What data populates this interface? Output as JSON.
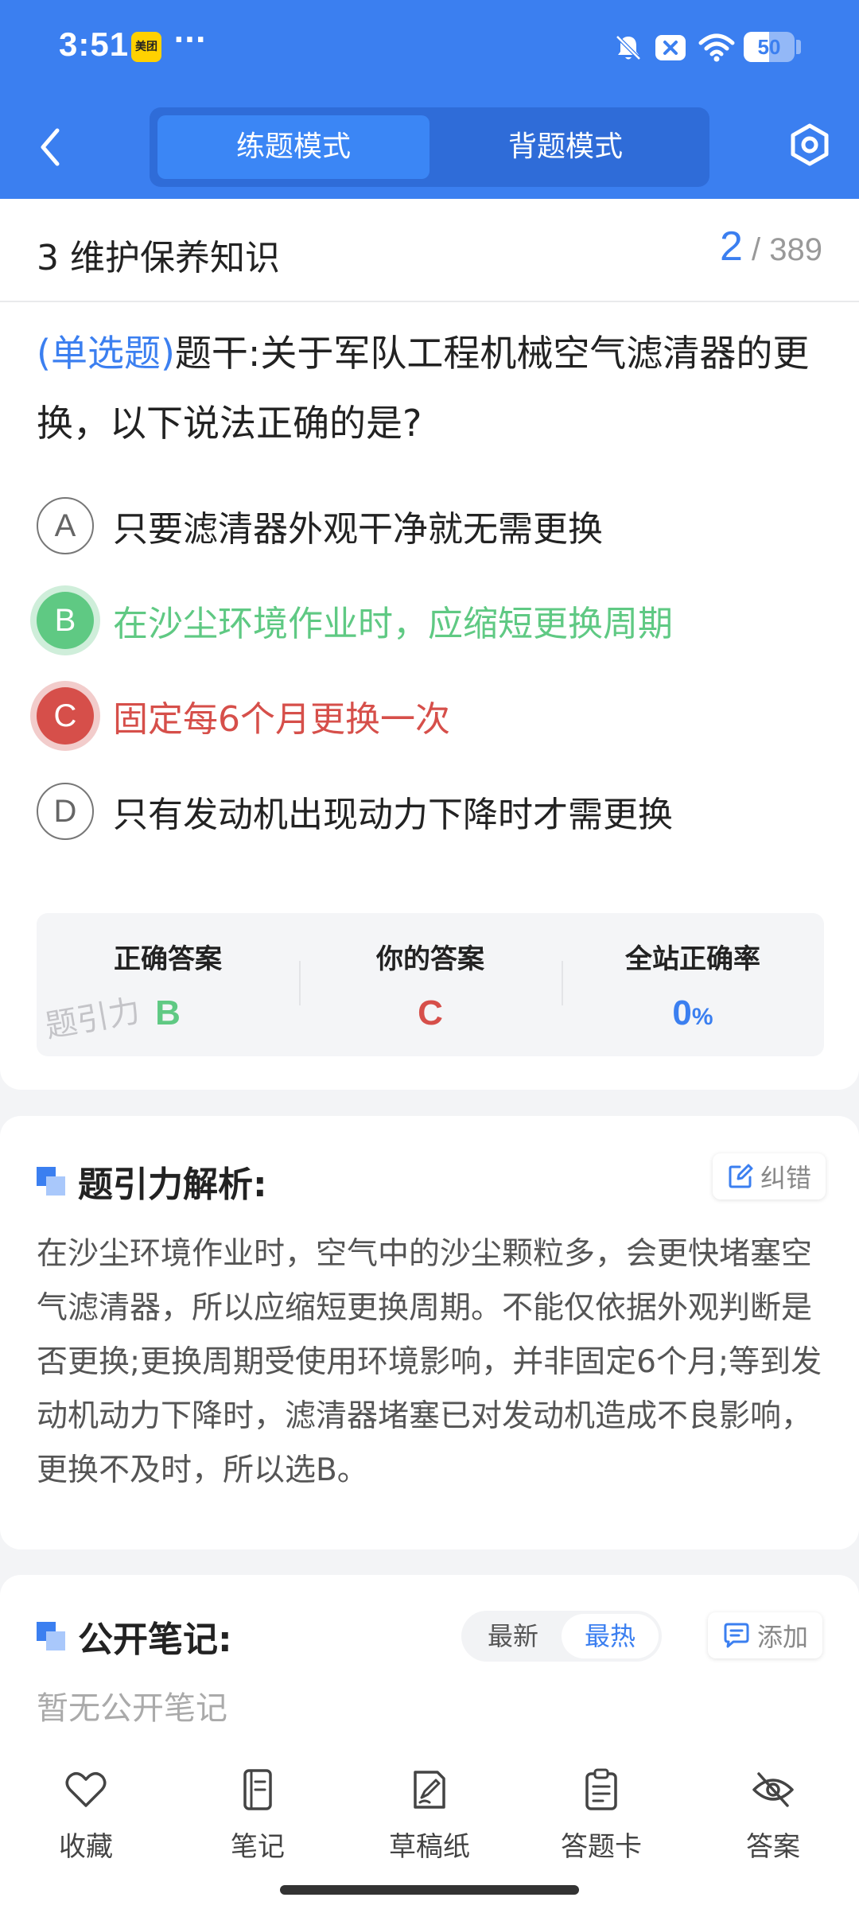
{
  "status_bar": {
    "time": "3:51",
    "app_badge": "美团",
    "more": "···",
    "battery": "50",
    "battery_level": 0.5
  },
  "header": {
    "modes": [
      {
        "label": "练题模式",
        "active": true
      },
      {
        "label": "背题模式",
        "active": false
      }
    ],
    "back_icon": "chevron-left-icon",
    "settings_icon": "hexagon-settings-icon",
    "accent_color": "#3b7ff0"
  },
  "question": {
    "chapter": "3 维护保养知识",
    "current": "2",
    "separator": "/",
    "total": "389",
    "type_tag": "(单选题)",
    "stem": "题干:关于军队工程机械空气滤清器的更换，以下说法正确的是?",
    "options": [
      {
        "letter": "A",
        "text": "只要滤清器外观干净就无需更换",
        "state": "normal"
      },
      {
        "letter": "B",
        "text": "在沙尘环境作业时，应缩短更换周期",
        "state": "correct"
      },
      {
        "letter": "C",
        "text": "固定每6个月更换一次",
        "state": "wrong"
      },
      {
        "letter": "D",
        "text": "只有发动机出现动力下降时才需更换",
        "state": "normal"
      }
    ]
  },
  "answer_summary": {
    "correct_label": "正确答案",
    "correct_value": "B",
    "yours_label": "你的答案",
    "yours_value": "C",
    "rate_label": "全站正确率",
    "rate_value": "0",
    "rate_unit": "%",
    "watermark": "题引力"
  },
  "analysis": {
    "title": "题引力解析:",
    "report_label": "纠错",
    "text": "在沙尘环境作业时，空气中的沙尘颗粒多，会更快堵塞空气滤清器，所以应缩短更换周期。不能仅依据外观判断是否更换;更换周期受使用环境影响，并非固定6个月;等到发动机动力下降时，滤清器堵塞已对发动机造成不良影响，更换不及时，所以选B。"
  },
  "notes": {
    "title": "公开笔记:",
    "sort_options": [
      {
        "label": "最新",
        "active": false
      },
      {
        "label": "最热",
        "active": true
      }
    ],
    "add_label": "添加",
    "empty_text": "暂无公开笔记"
  },
  "bottom_bar": [
    {
      "label": "收藏",
      "icon": "heart-icon"
    },
    {
      "label": "笔记",
      "icon": "notebook-icon"
    },
    {
      "label": "草稿纸",
      "icon": "draft-pen-icon"
    },
    {
      "label": "答题卡",
      "icon": "clipboard-icon"
    },
    {
      "label": "答案",
      "icon": "eye-off-icon"
    }
  ]
}
